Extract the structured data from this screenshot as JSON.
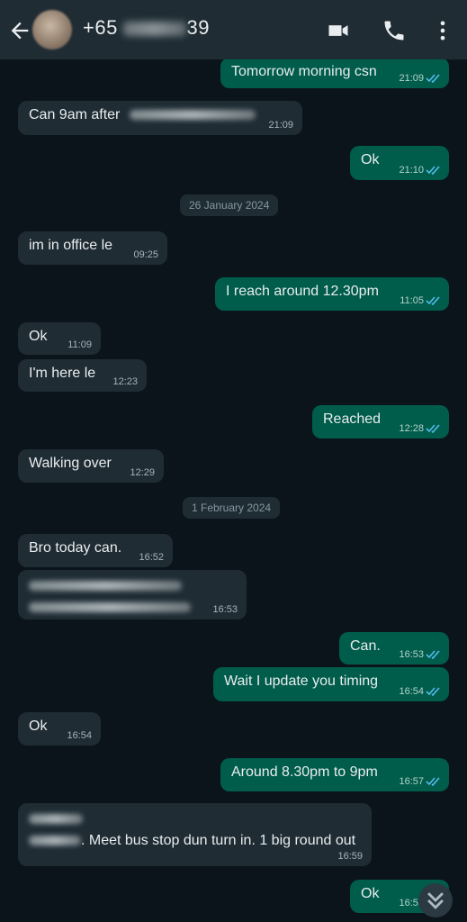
{
  "header": {
    "title_prefix": "+65",
    "title_suffix": "39"
  },
  "date_chips": [
    "26 January 2024",
    "1 February 2024"
  ],
  "messages": [
    {
      "text": "Tomorrow morning csn",
      "time": "21:09"
    },
    {
      "text": "Can 9am after",
      "time": "21:09"
    },
    {
      "text": "Ok",
      "time": "21:10"
    },
    {
      "text": "im in office le",
      "time": "09:25"
    },
    {
      "text": "I reach around 12.30pm",
      "time": "11:05"
    },
    {
      "text": "Ok",
      "time": "11:09"
    },
    {
      "text": "I'm here le",
      "time": "12:23"
    },
    {
      "text": "Reached",
      "time": "12:28"
    },
    {
      "text": "Walking over",
      "time": "12:29"
    },
    {
      "text": "Bro today can.",
      "time": "16:52"
    },
    {
      "text": "",
      "time": "16:53"
    },
    {
      "text": "Can.",
      "time": "16:53"
    },
    {
      "text": "Wait I update you timing",
      "time": "16:54"
    },
    {
      "text": "Ok",
      "time": "16:54"
    },
    {
      "text": "Around 8.30pm to 9pm",
      "time": "16:57"
    },
    {
      "text": ". Meet bus stop dun turn in. 1 big round out",
      "time": "16:59"
    },
    {
      "text": "Ok",
      "time": "16:59"
    }
  ],
  "colors": {
    "incoming_bubble": "#1f2c34",
    "outgoing_bubble": "#005c4b",
    "read_ticks": "#53bdeb",
    "background": "#0b141a"
  },
  "icons": [
    "back-arrow-icon",
    "video-call-icon",
    "phone-icon",
    "more-options-icon",
    "read-ticks-icon",
    "scroll-down-icon"
  ]
}
